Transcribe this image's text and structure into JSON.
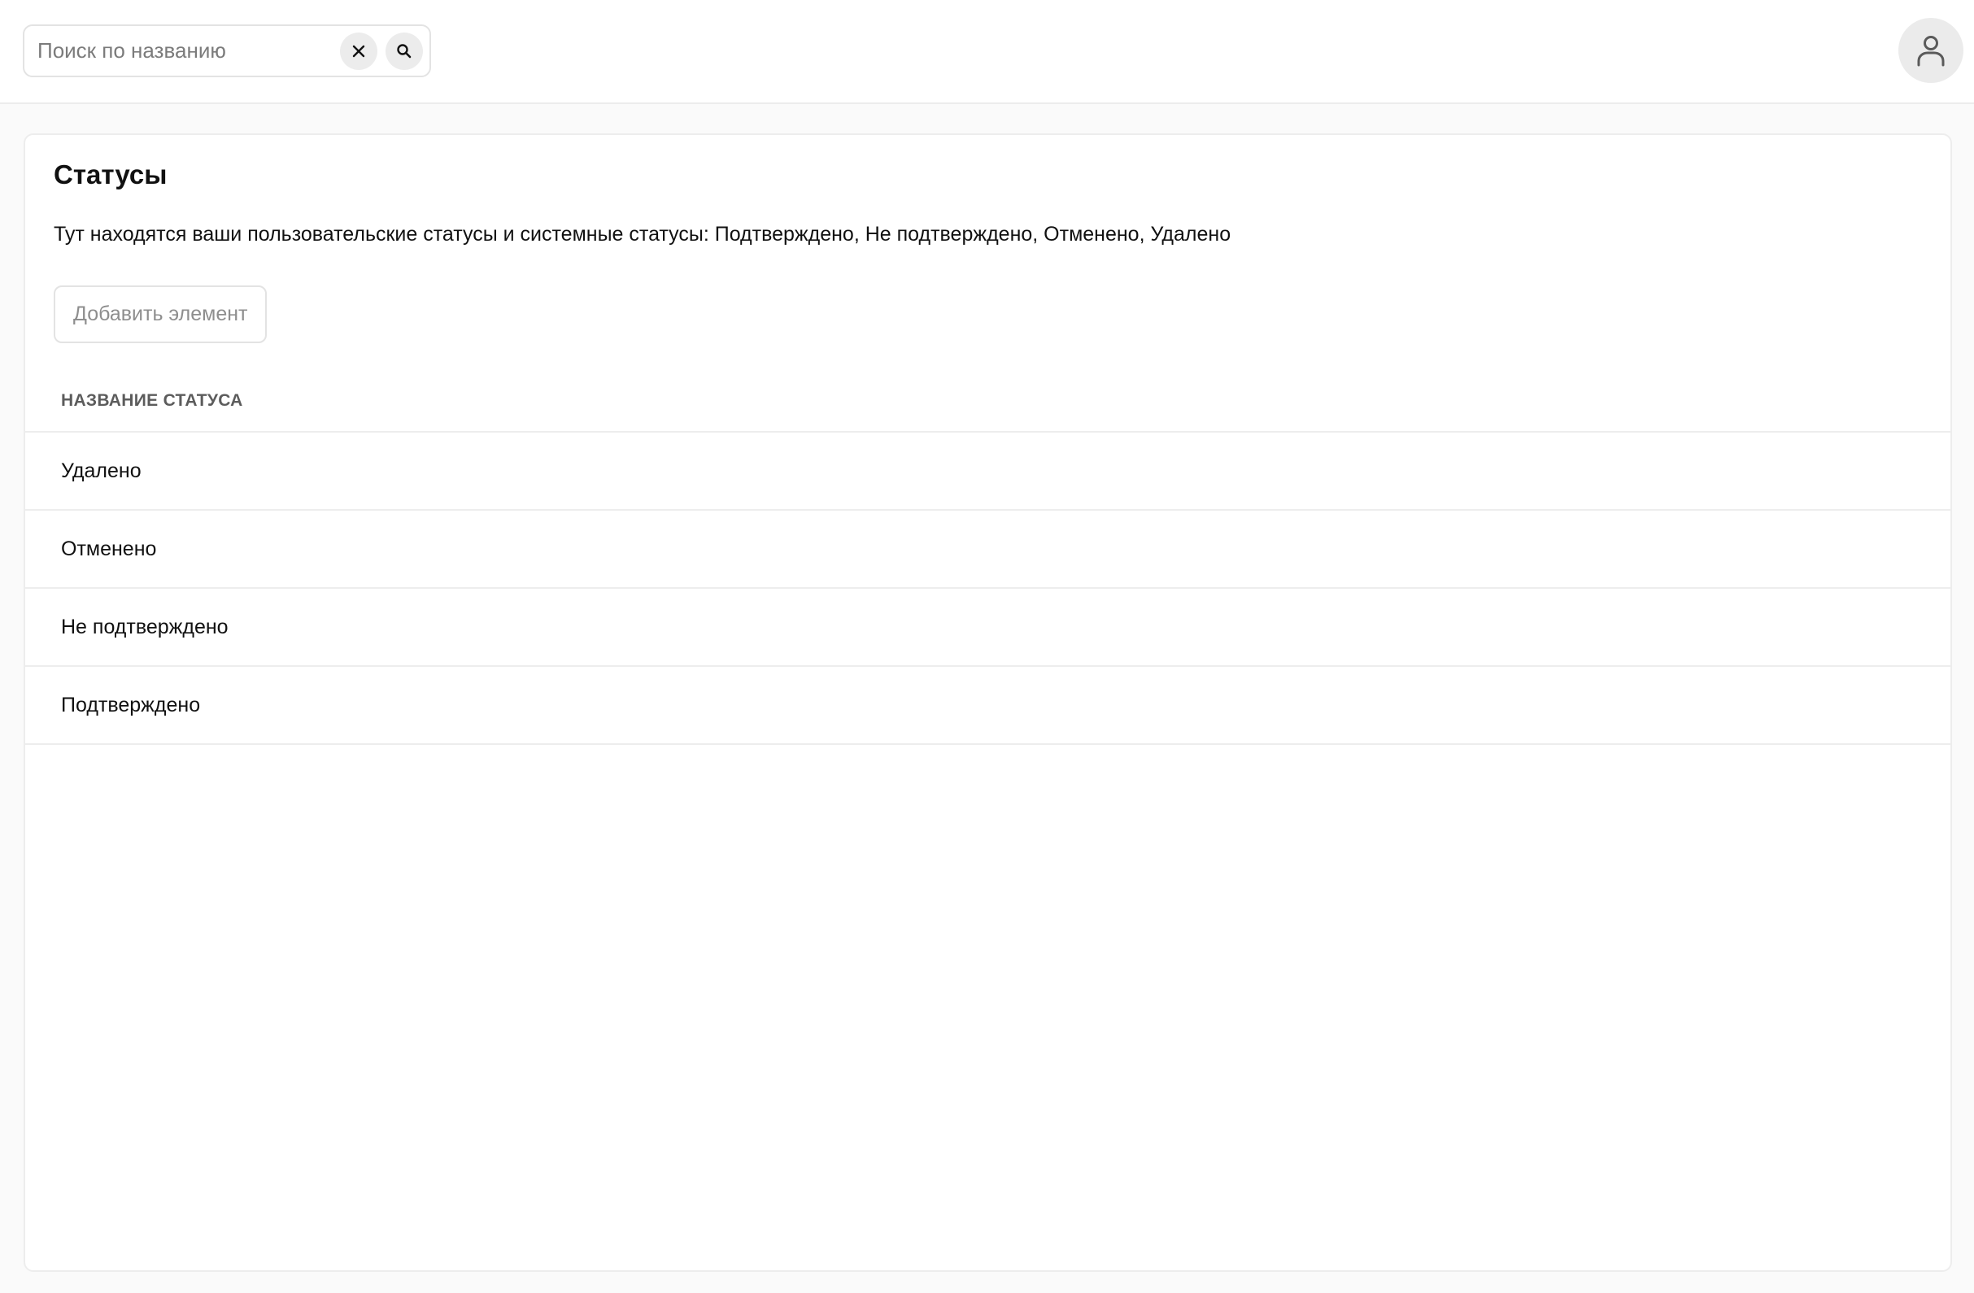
{
  "header": {
    "search": {
      "placeholder": "Поиск по названию",
      "value": "",
      "clear_icon": "close-icon",
      "search_icon": "search-icon"
    },
    "avatar_icon": "user-icon"
  },
  "main": {
    "title": "Статусы",
    "description": "Тут находятся ваши пользовательские статусы и системные статусы: Подтверждено, Не подтверждено, Отменено, Удалено",
    "add_button_label": "Добавить элемент",
    "table": {
      "columns": [
        "НАЗВАНИЕ СТАТУСА"
      ],
      "rows": [
        {
          "name": "Удалено"
        },
        {
          "name": "Отменено"
        },
        {
          "name": "Не подтверждено"
        },
        {
          "name": "Подтверждено"
        }
      ]
    }
  },
  "colors": {
    "page_background": "#fafafa",
    "surface": "#ffffff",
    "border": "#ededed",
    "muted_text": "#8e8e8e",
    "header_text": "#5c5c5c",
    "icon_button_bg": "#ececec"
  }
}
